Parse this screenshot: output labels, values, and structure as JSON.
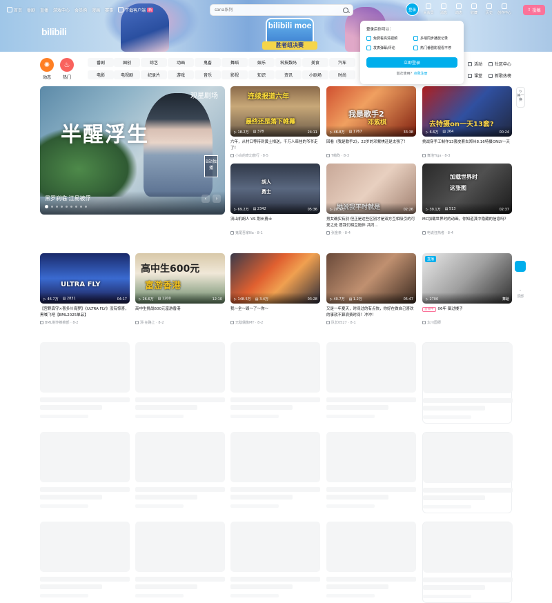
{
  "topnav": {
    "items": [
      "首页",
      "番剧",
      "直播",
      "游戏中心",
      "会员购",
      "漫画",
      "赛事"
    ],
    "download": "下载客户端",
    "download_badge": "新"
  },
  "search": {
    "placeholder": "sana系列"
  },
  "user": {
    "login": "登录",
    "icons": [
      "大会员",
      "消息",
      "动态",
      "收藏",
      "历史",
      "创作中心"
    ],
    "upload": "投稿"
  },
  "banner": {
    "logo": "bilibili",
    "moe_title": "bilibili moe",
    "moe_sub": "胜者组决赛"
  },
  "channels": {
    "dynamic": "动态",
    "hot": "热门",
    "tags_row1": [
      "番剧",
      "国创",
      "综艺",
      "动画",
      "鬼畜",
      "舞蹈",
      "娱乐",
      "科技数码",
      "美食",
      "汽车"
    ],
    "tags_row2": [
      "电影",
      "电视剧",
      "纪录片",
      "游戏",
      "音乐",
      "影视",
      "知识",
      "资讯",
      "小剧场",
      "时尚"
    ],
    "extras_row1": [
      "活动",
      "社区中心"
    ],
    "extras_row2": [
      "课堂",
      "新歌热榜"
    ]
  },
  "login_popup": {
    "title": "登录后你可以：",
    "benefits": [
      "免费看高清视频",
      "多端同步播放记录",
      "发表弹幕/评论",
      "热门番剧影视看不停"
    ],
    "button": "立即登录",
    "register_prefix": "首次使用？",
    "register_link": "点我注册"
  },
  "carousel": {
    "title": "黑罗刹临 江易被俘",
    "calligraphy": "半醒浮生",
    "brand": "观星剧场",
    "badge": "B站独播",
    "dot_count": 9,
    "active_dot": 0
  },
  "videos_row1": [
    {
      "title": "六年，从村口等待到黄土相送，千万人牵挂的爷爷走了！",
      "uploader": "小白的奇幻旅行",
      "date": "8-5",
      "views": "18.2万",
      "danmaku": "378",
      "duration": "24:11",
      "overlay": "连续报道六年",
      "overlay2": "最终还是落下帷幕"
    },
    {
      "title": "回看《我是歌手2》，22岁的邓紫棋还是太强了！",
      "uploader": "T萌昀",
      "date": "8-3",
      "views": "46.8万",
      "danmaku": "1767",
      "duration": "33:38",
      "overlay": "我是歌手2",
      "overlay2": "邓紫棋"
    },
    {
      "title": "挑战穿手工制作13套皮套去郑州8.16特摄ONLY一天",
      "uploader": "舞泡Tiga",
      "date": "8-3",
      "views": "6.6万",
      "danmaku": "264",
      "duration": "00:24",
      "overlay": "去特摄on一天13套?",
      "overlay2": ""
    }
  ],
  "videos_row2": [
    {
      "title": "流山机胡人 VS 荆州勇士",
      "uploader": "鬼尾吾家Na",
      "date": "8-1",
      "views": "69.2万",
      "danmaku": "2342",
      "duration": "05:36",
      "overlay": "胡人",
      "overlay2": "勇士"
    },
    {
      "title": "男女确实有别 但正是这些区别才是双方互相吸引的可爱之处 愿我们相互陪伴 共同...",
      "uploader": "张金条",
      "date": "8-4",
      "views": "20.9万",
      "danmaku": "",
      "duration": "02:26",
      "overlay": "她说我平时就是",
      "overlay2": ""
    },
    {
      "title": "MC加载世界时的动画，你知道其中隐藏的信息吗？",
      "uploader": "电说狂热者",
      "date": "8-4",
      "views": "39.1万",
      "danmaku": "513",
      "duration": "02:37",
      "overlay": "加载世界时",
      "overlay2": "这张图"
    }
  ],
  "videos_row3": [
    {
      "title": "【宫野真守×喜多川海梦】《ULTRA FLY》没有惊喜，黑喊飞吧【BML2025单品】",
      "uploader": "BML制作推推部",
      "date": "8-2",
      "views": "46.7万",
      "danmaku": "2831",
      "duration": "04:17",
      "overlay": "ULTRA FLY",
      "overlay2": ""
    },
    {
      "title": "高中生挑战600元富游香港",
      "uploader": "漂·在路上",
      "date": "8-2",
      "views": "26.6万",
      "danmaku": "1200",
      "duration": "12:10",
      "overlay": "高中生600元",
      "overlay2": "富游香港"
    },
    {
      "title": "我～全～毁～了～你～",
      "uploader": "无敌偶像MY",
      "date": "8-2",
      "views": "148.5万",
      "danmaku": "3.4万",
      "duration": "03:28",
      "overlay": "",
      "overlay2": ""
    },
    {
      "title": "又是一年夏天，时间过的有点快，你好在做自己喜欢的事就不算浪费时间！冲冲！",
      "uploader": "队长0527",
      "date": "8-1",
      "views": "40.7万",
      "danmaku": "1.2万",
      "duration": "05:47",
      "overlay": "",
      "overlay2": ""
    },
    {
      "title": "06年 御过楼子",
      "uploader": "太川国卿",
      "date": "",
      "views": "2700",
      "danmaku": "",
      "duration": "舞蹈",
      "overlay": "",
      "overlay2": "",
      "live": "直播",
      "live_tag": "直播中"
    }
  ],
  "side": {
    "refresh": "换一换",
    "back_top": "顶部"
  },
  "colors": {
    "brand_blue": "#00aeec",
    "brand_pink": "#fb7299",
    "dynamic": "#ff7f24",
    "hot": "#f9625d"
  }
}
